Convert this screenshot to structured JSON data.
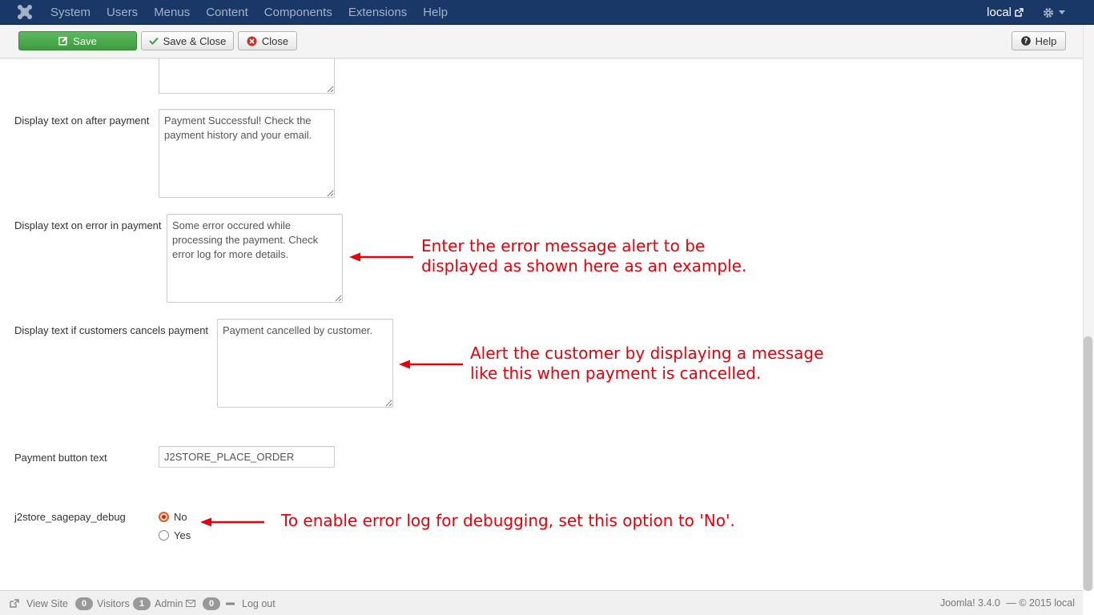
{
  "navbar": {
    "menu": [
      "System",
      "Users",
      "Menus",
      "Content",
      "Components",
      "Extensions",
      "Help"
    ],
    "site_label": "local"
  },
  "toolbar": {
    "save_label": "Save",
    "save_close_label": "Save & Close",
    "close_label": "Close",
    "help_label": "Help"
  },
  "form": {
    "after_payment_label": "Display text on after payment",
    "after_payment_value": "Payment Successful! Check the payment history and your email.",
    "error_payment_label": "Display text on error in payment",
    "error_payment_value": "Some error occured while processing the payment. Check error log for more details.",
    "cancel_payment_label": "Display text if customers cancels payment",
    "cancel_payment_value": "Payment cancelled by customer.",
    "button_text_label": "Payment button text",
    "button_text_value": "J2STORE_PLACE_ORDER",
    "debug_label": "j2store_sagepay_debug",
    "debug_options": [
      "No",
      "Yes"
    ],
    "debug_selected": "No"
  },
  "annotations": {
    "error_line1": "Enter the error message alert to be",
    "error_line2": "displayed as shown here as an example.",
    "cancel_line1": "Alert the customer by displaying a message",
    "cancel_line2": "like this when payment is cancelled.",
    "debug_line": "To enable error log for debugging, set this option to 'No'.",
    "color": "#e8000b"
  },
  "footer": {
    "view_site": "View Site",
    "visitors_count": "0",
    "visitors_label": "Visitors",
    "admin_count": "1",
    "admin_label": "Admin",
    "messages_count": "0",
    "logout_label": "Log out",
    "version": "Joomla! 3.4.0",
    "copyright": "— © 2015 local"
  },
  "colors": {
    "navbar_bg": "#1a3867",
    "save_button": "#46a546"
  }
}
